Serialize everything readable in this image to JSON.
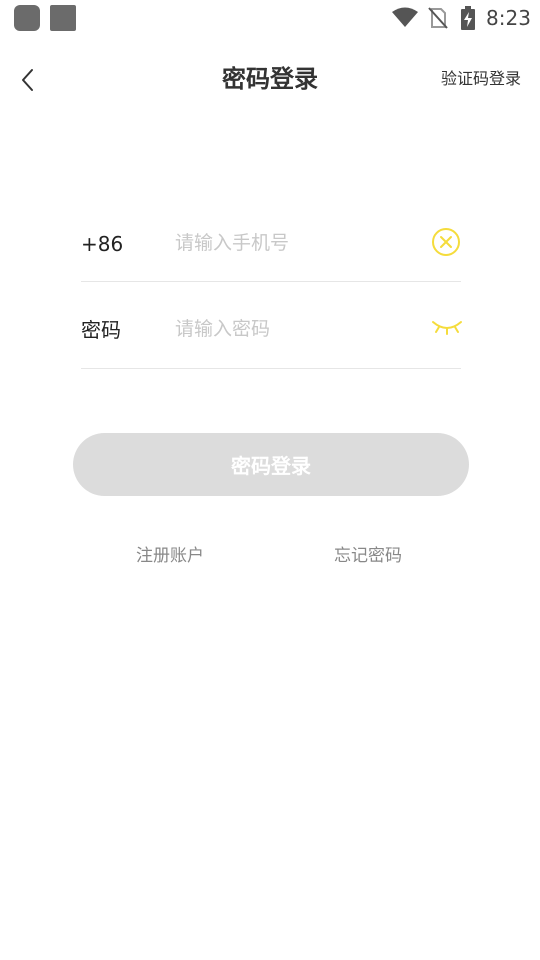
{
  "status_bar": {
    "time": "8:23",
    "icons": [
      "app-icon",
      "app-icon",
      "wifi-icon",
      "no-sim-icon",
      "battery-charging-icon"
    ]
  },
  "header": {
    "title": "密码登录",
    "alt_login_label": "验证码登录"
  },
  "phone_row": {
    "prefix": "+86",
    "placeholder": "请输入手机号",
    "value": ""
  },
  "password_row": {
    "label": "密码",
    "placeholder": "请输入密码",
    "value": ""
  },
  "login_button": {
    "label": "密码登录"
  },
  "links": {
    "register": "注册账户",
    "forgot_password": "忘记密码"
  },
  "colors": {
    "accent": "#f5dc3c",
    "button_disabled": "#dcdcdc",
    "placeholder": "#c8c8c8",
    "divider": "#e6e6e6"
  }
}
